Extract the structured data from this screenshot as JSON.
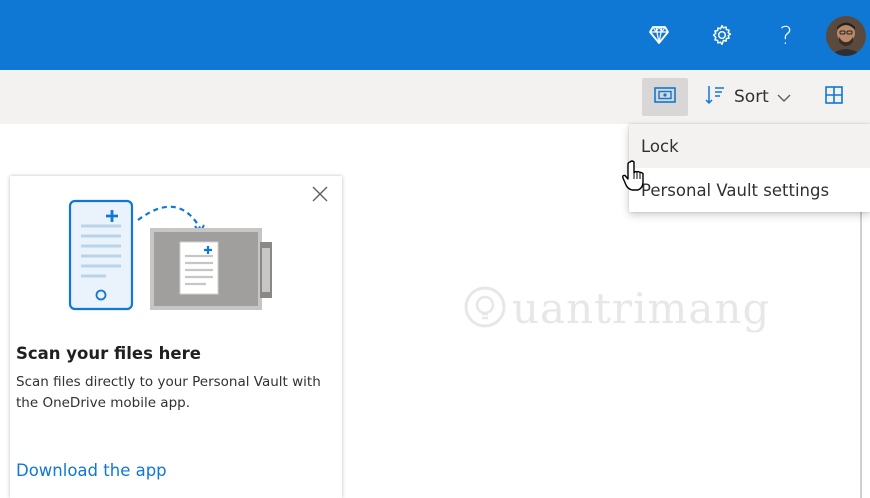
{
  "colors": {
    "accent": "#0f78d4",
    "toolbar_bg": "#f3f2f1",
    "vault_illustration_gray": "#a19f9d"
  },
  "header": {
    "premium_icon": "diamond-icon",
    "settings_icon": "gear-icon",
    "help_glyph": "?",
    "avatar_icon": "user-avatar"
  },
  "toolbar": {
    "vault_button_icon": "personal-vault-icon",
    "sort_label": "Sort",
    "sort_icon": "sort-arrows-icon",
    "sort_chevron_icon": "chevron-down-icon",
    "view_icon": "grid-view-icon"
  },
  "menu": {
    "items": [
      {
        "label": "Lock"
      },
      {
        "label": "Personal Vault settings"
      }
    ]
  },
  "scan_card": {
    "title": "Scan your files here",
    "description": "Scan files directly to your Personal Vault with the OneDrive mobile app.",
    "link": "Download the app",
    "close_icon": "close-icon"
  },
  "watermark": {
    "text": "uantrimang"
  }
}
